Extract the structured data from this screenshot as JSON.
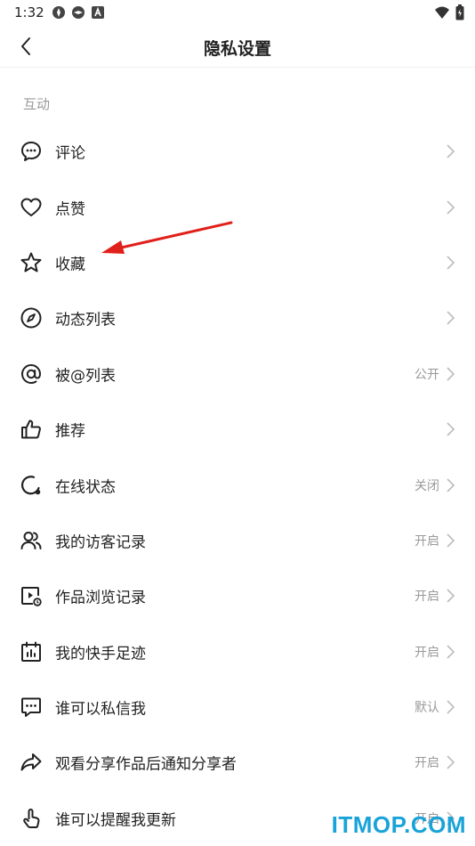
{
  "status_bar": {
    "time": "1:32"
  },
  "header": {
    "title": "隐私设置"
  },
  "section": {
    "label": "互动"
  },
  "rows": [
    {
      "icon": "comment-icon",
      "label": "评论",
      "value": ""
    },
    {
      "icon": "heart-icon",
      "label": "点赞",
      "value": ""
    },
    {
      "icon": "star-icon",
      "label": "收藏",
      "value": ""
    },
    {
      "icon": "compass-icon",
      "label": "动态列表",
      "value": ""
    },
    {
      "icon": "at-icon",
      "label": "被@列表",
      "value": "公开"
    },
    {
      "icon": "thumbs-up-icon",
      "label": "推荐",
      "value": ""
    },
    {
      "icon": "online-status-icon",
      "label": "在线状态",
      "value": "关闭"
    },
    {
      "icon": "visitors-icon",
      "label": "我的访客记录",
      "value": "开启"
    },
    {
      "icon": "video-history-icon",
      "label": "作品浏览记录",
      "value": "开启"
    },
    {
      "icon": "calendar-icon",
      "label": "我的快手足迹",
      "value": "开启"
    },
    {
      "icon": "message-icon",
      "label": "谁可以私信我",
      "value": "默认"
    },
    {
      "icon": "share-icon",
      "label": "观看分享作品后通知分享者",
      "value": "开启"
    },
    {
      "icon": "tap-hand-icon",
      "label": "谁可以提醒我更新",
      "value": "开启"
    }
  ],
  "watermark": "ITMOP.COM",
  "colors": {
    "annotation_arrow": "#e0201b",
    "watermark": "#1aa3d9",
    "muted_text": "#999999"
  }
}
